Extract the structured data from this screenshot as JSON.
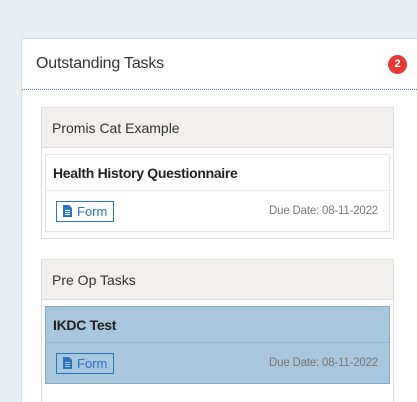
{
  "panel": {
    "title": "Outstanding Tasks",
    "count": "2"
  },
  "groups": [
    {
      "name": "Promis Cat Example",
      "tasks": [
        {
          "name": "Health History Questionnaire",
          "button_label": "Form",
          "due": "Due Date: 08-11-2022",
          "selected": false
        }
      ]
    },
    {
      "name": "Pre Op Tasks",
      "tasks": [
        {
          "name": "IKDC Test",
          "button_label": "Form",
          "due": "Due Date: 08-11-2022",
          "selected": true
        }
      ]
    }
  ],
  "colors": {
    "accent": "#2a74c0",
    "badge": "#e53935",
    "selected_row": "#a8c6dc"
  },
  "icons": {
    "form": "document-icon"
  }
}
